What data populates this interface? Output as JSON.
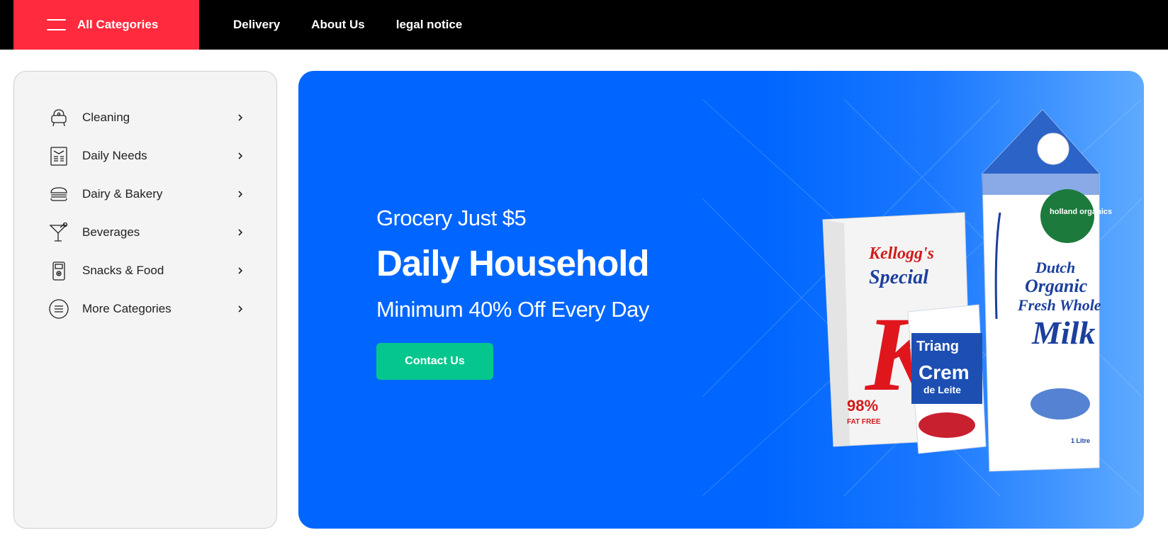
{
  "header": {
    "all_categories_label": "All Categories",
    "nav": [
      {
        "label": "Delivery"
      },
      {
        "label": "About Us"
      },
      {
        "label": "legal notice"
      }
    ]
  },
  "sidebar": {
    "items": [
      {
        "label": "Cleaning",
        "icon": "cleaning-icon"
      },
      {
        "label": "Daily Needs",
        "icon": "daily-needs-icon"
      },
      {
        "label": "Dairy & Bakery",
        "icon": "burger-icon"
      },
      {
        "label": "Beverages",
        "icon": "cocktail-icon"
      },
      {
        "label": "Snacks & Food",
        "icon": "snack-machine-icon"
      },
      {
        "label": "More Categories",
        "icon": "menu-circle-icon"
      }
    ]
  },
  "hero": {
    "subtitle": "Grocery Just $5",
    "title": "Daily Household",
    "tagline": "Minimum 40% Off Every Day",
    "cta_label": "Contact Us",
    "products": {
      "cereal_brand": "Kellogg's",
      "cereal_name": "Special",
      "cereal_letter": "K",
      "cereal_badge": "98%",
      "cereal_badge_sub": "FAT FREE",
      "cream_brand": "Triang",
      "cream_name": "Crem",
      "cream_sub": "de Leite",
      "milk_brand": "holland organics",
      "milk_line1": "Dutch",
      "milk_line2": "Organic",
      "milk_line3": "Fresh Whole",
      "milk_line4": "Milk",
      "milk_volume": "1 Litre"
    }
  },
  "colors": {
    "topbar": "#000000",
    "accent_red": "#ff2a3d",
    "hero_blue": "#0066ff",
    "cta_green": "#05c78d",
    "sidebar_bg": "#f4f4f4"
  }
}
